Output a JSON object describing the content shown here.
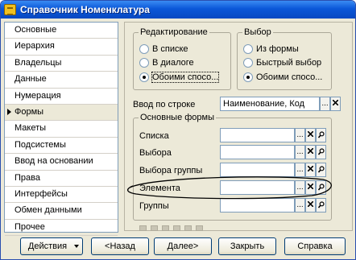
{
  "window": {
    "title": "Справочник Номенклатура"
  },
  "sidebar": {
    "items": [
      {
        "label": "Основные"
      },
      {
        "label": "Иерархия"
      },
      {
        "label": "Владельцы"
      },
      {
        "label": "Данные"
      },
      {
        "label": "Нумерация"
      },
      {
        "label": "Формы",
        "active": true
      },
      {
        "label": "Макеты"
      },
      {
        "label": "Подсистемы"
      },
      {
        "label": "Ввод на основании"
      },
      {
        "label": "Права"
      },
      {
        "label": "Интерфейсы"
      },
      {
        "label": "Обмен данными"
      },
      {
        "label": "Прочее"
      }
    ]
  },
  "editing": {
    "legend": "Редактирование",
    "options": [
      "В списке",
      "В диалоге",
      "Обоими спосо..."
    ],
    "selected": 2
  },
  "choice": {
    "legend": "Выбор",
    "options": [
      "Из формы",
      "Быстрый выбор",
      "Обоими спосо..."
    ],
    "selected": 2
  },
  "input_by_string": {
    "label": "Ввод по строке",
    "value": "Наименование, Код"
  },
  "main_forms": {
    "legend": "Основные формы",
    "rows": [
      {
        "label": "Списка",
        "value": ""
      },
      {
        "label": "Выбора",
        "value": ""
      },
      {
        "label": "Выбора группы",
        "value": ""
      },
      {
        "label": "Элемента",
        "value": ""
      },
      {
        "label": "Группы",
        "value": ""
      }
    ],
    "ellipsis": "..."
  },
  "footer": {
    "actions": "Действия",
    "back": "<Назад",
    "next": "Далее>",
    "close": "Закрыть",
    "help": "Справка"
  }
}
